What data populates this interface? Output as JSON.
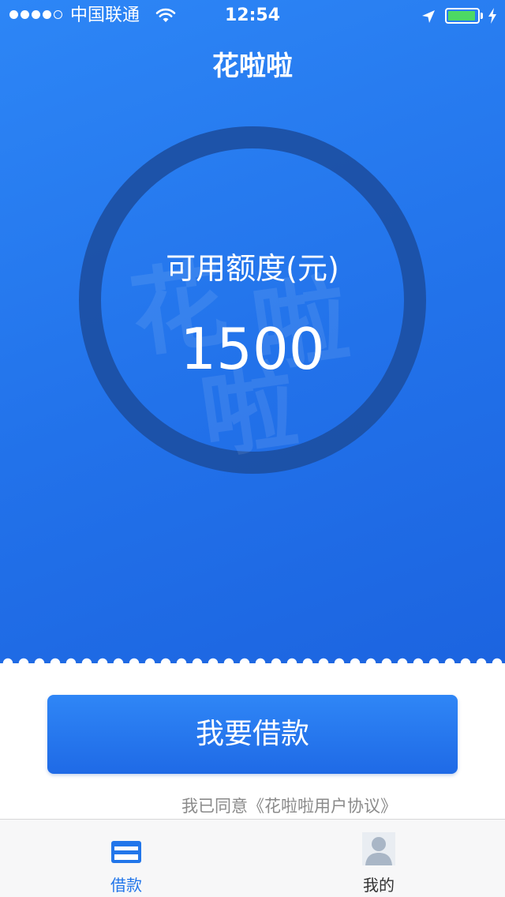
{
  "status_bar": {
    "carrier": "中国联通",
    "time": "12:54",
    "battery_level": 0.95
  },
  "header": {
    "title": "花啦啦"
  },
  "credit": {
    "label": "可用额度(元)",
    "amount": "1500",
    "watermark_chars": [
      "花",
      "啦",
      "啦"
    ]
  },
  "actions": {
    "borrow_label": "我要借款"
  },
  "agreement": {
    "prefix": "我已同意",
    "link": "《花啦啦用户协议》"
  },
  "tab_bar": {
    "items": [
      {
        "label": "借款",
        "icon": "card-icon",
        "active": true
      },
      {
        "label": "我的",
        "icon": "user-avatar-icon",
        "active": false
      }
    ]
  },
  "colors": {
    "primary": "#2276ea",
    "ring": "#1c4fa3",
    "battery": "#4cd964"
  }
}
